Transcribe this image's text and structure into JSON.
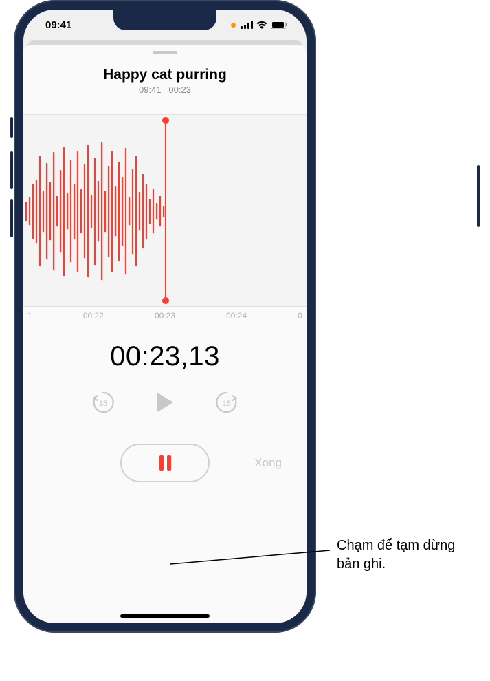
{
  "status": {
    "time": "09:41"
  },
  "recording": {
    "title": "Happy cat purring",
    "meta_time": "09:41",
    "meta_duration": "00:23"
  },
  "ruler": {
    "t0": "1",
    "t1": "00:22",
    "t2": "00:23",
    "t3": "00:24",
    "t4": "0"
  },
  "timer": "00:23,13",
  "skip_back_num": "15",
  "skip_fwd_num": "15",
  "done_label": "Xong",
  "callout": "Chạm để tạm dừng bản ghi."
}
